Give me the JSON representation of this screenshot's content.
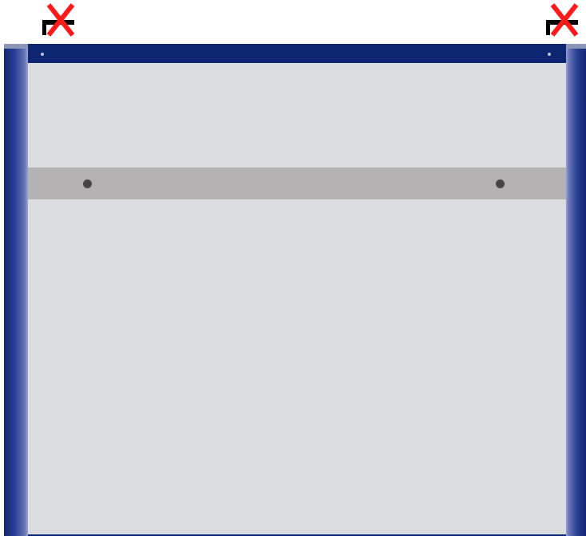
{
  "markers": {
    "left": {
      "icon": "corner-x-icon",
      "stroke_color": "#000000",
      "x_color": "#ff1a1a"
    },
    "right": {
      "icon": "corner-x-icon",
      "stroke_color": "#000000",
      "x_color": "#ff1a1a"
    }
  },
  "colors": {
    "frame_blue": "#142576",
    "rail_blue": "#0e2572",
    "panel_gray": "#dcdde0",
    "band_gray": "#b3b1b2",
    "hole_dark": "#454545"
  }
}
